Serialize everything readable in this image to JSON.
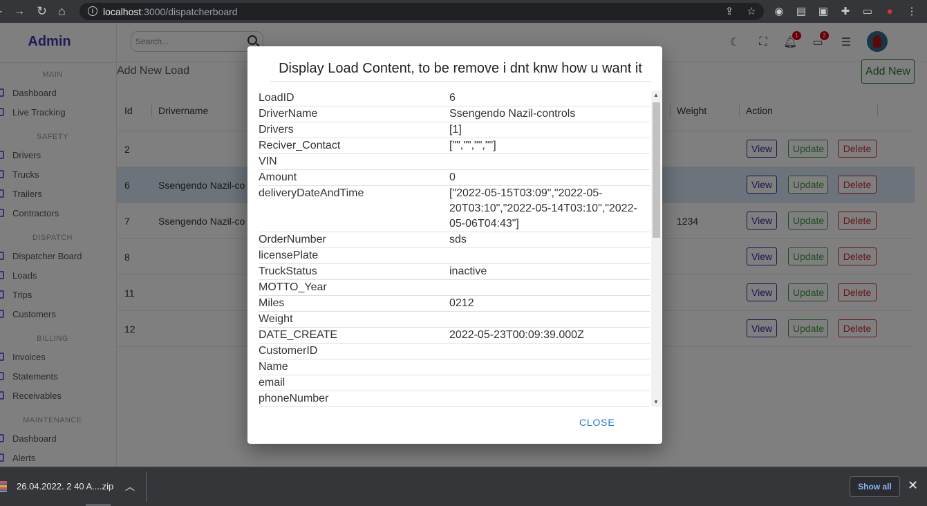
{
  "browser": {
    "url_host": "localhost",
    "url_path": ":3000/dispatcherboard",
    "icons": [
      "back-icon",
      "forward-icon",
      "reload-icon",
      "home-icon",
      "share-icon",
      "star-icon",
      "extension-icon",
      "puzzle-icon",
      "sidepanel-icon",
      "profile-icon",
      "menu-icon"
    ]
  },
  "sidebar": {
    "brand": "Admin",
    "sections": [
      {
        "title": "MAIN",
        "items": [
          "Dashboard",
          "Live Tracking"
        ]
      },
      {
        "title": "SAFETY",
        "items": [
          "Drivers",
          "Trucks",
          "Trailers",
          "Contractors"
        ]
      },
      {
        "title": "DISPATCH",
        "items": [
          "Dispatcher Board",
          "Loads",
          "Trips",
          "Customers"
        ]
      },
      {
        "title": "BILLING",
        "items": [
          "Invoices",
          "Statements",
          "Receivables"
        ]
      },
      {
        "title": "MAINTENANCE",
        "items": [
          "Dashboard",
          "Alerts"
        ]
      }
    ]
  },
  "topbar": {
    "search_placeholder": "Search...",
    "notifications_count": "1",
    "messages_count": "2"
  },
  "page": {
    "title": "Add New Load",
    "add_button": "Add New"
  },
  "table": {
    "headers": [
      "Id",
      "Drivername",
      "Weight",
      "Action"
    ],
    "rows": [
      {
        "id": "2",
        "driver": "",
        "weight": ""
      },
      {
        "id": "6",
        "driver": "Ssengendo Nazil-co",
        "weight": ""
      },
      {
        "id": "7",
        "driver": "Ssengendo Nazil-co",
        "weight": "1234"
      },
      {
        "id": "8",
        "driver": "",
        "weight": ""
      },
      {
        "id": "11",
        "driver": "",
        "weight": ""
      },
      {
        "id": "12",
        "driver": "",
        "weight": ""
      }
    ],
    "view_label": "View",
    "update_label": "Update",
    "delete_label": "Delete"
  },
  "modal": {
    "title": "Display Load Content, to be remove i dnt knw how u want it",
    "fields": [
      {
        "key": "LoadID",
        "value": "6"
      },
      {
        "key": "DriverName",
        "value": "Ssengendo Nazil-controls"
      },
      {
        "key": "Drivers",
        "value": "[1]"
      },
      {
        "key": "Reciver_Contact",
        "value": "[\"\",\"\",\"\",\"\"]"
      },
      {
        "key": "VIN",
        "value": ""
      },
      {
        "key": "Amount",
        "value": "0"
      },
      {
        "key": "deliveryDateAndTime",
        "value": "[\"2022-05-15T03:09\",\"2022-05-20T03:10\",\"2022-05-14T03:10\",\"2022-05-06T04:43\"]"
      },
      {
        "key": "OrderNumber",
        "value": "sds"
      },
      {
        "key": "licensePlate",
        "value": ""
      },
      {
        "key": "TruckStatus",
        "value": "inactive"
      },
      {
        "key": "MOTTO_Year",
        "value": ""
      },
      {
        "key": "Miles",
        "value": "0212"
      },
      {
        "key": "Weight",
        "value": ""
      },
      {
        "key": "DATE_CREATE",
        "value": "2022-05-23T00:09:39.000Z"
      },
      {
        "key": "CustomerID",
        "value": ""
      },
      {
        "key": "Name",
        "value": ""
      },
      {
        "key": "email",
        "value": ""
      },
      {
        "key": "phoneNumber",
        "value": ""
      }
    ],
    "close_label": "CLOSE"
  },
  "downloads": {
    "file_name": "26.04.2022. 2 40 A....zip",
    "show_all": "Show all"
  }
}
